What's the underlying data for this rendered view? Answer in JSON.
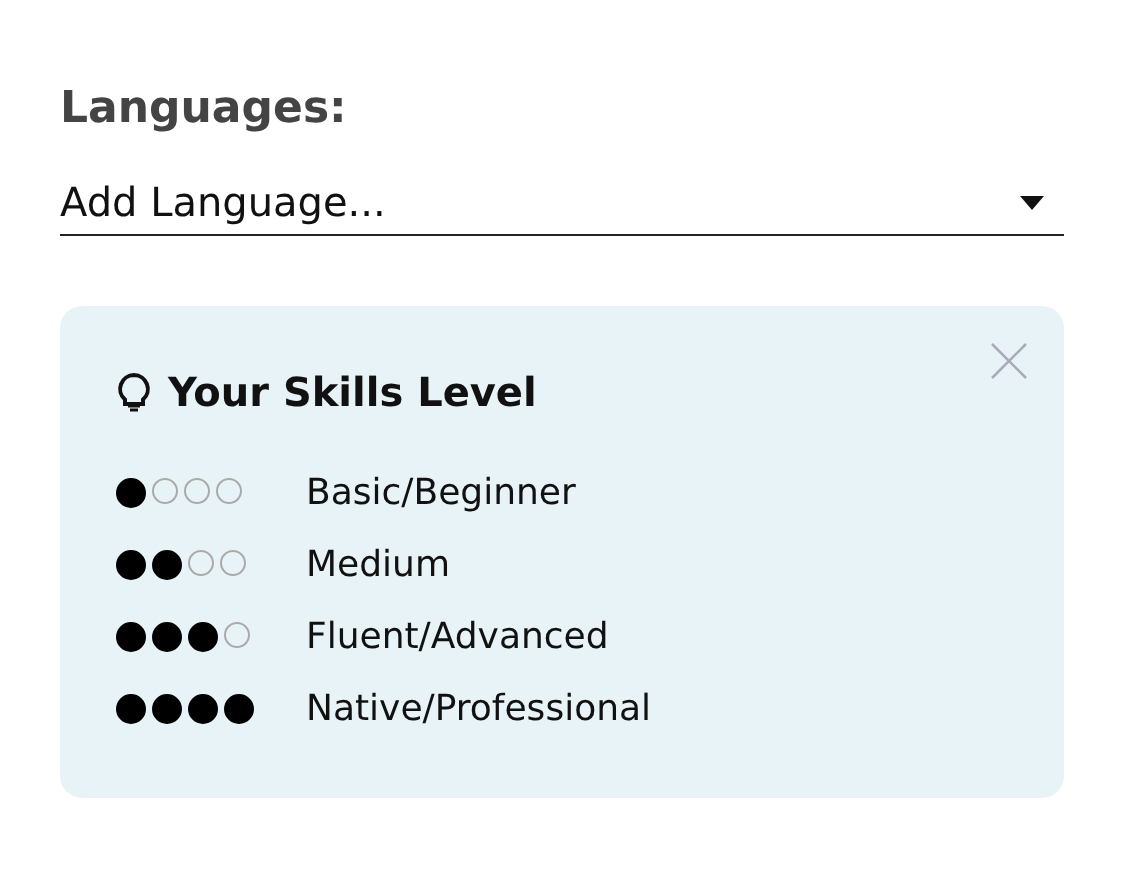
{
  "label": "Languages:",
  "dropdown": {
    "placeholder": "Add Language..."
  },
  "skills_card": {
    "title": "Your Skills Level",
    "levels": [
      {
        "stars": 1,
        "label": "Basic/Beginner"
      },
      {
        "stars": 2,
        "label": "Medium"
      },
      {
        "stars": 3,
        "label": "Fluent/Advanced"
      },
      {
        "stars": 4,
        "label": "Native/Professional"
      }
    ]
  }
}
